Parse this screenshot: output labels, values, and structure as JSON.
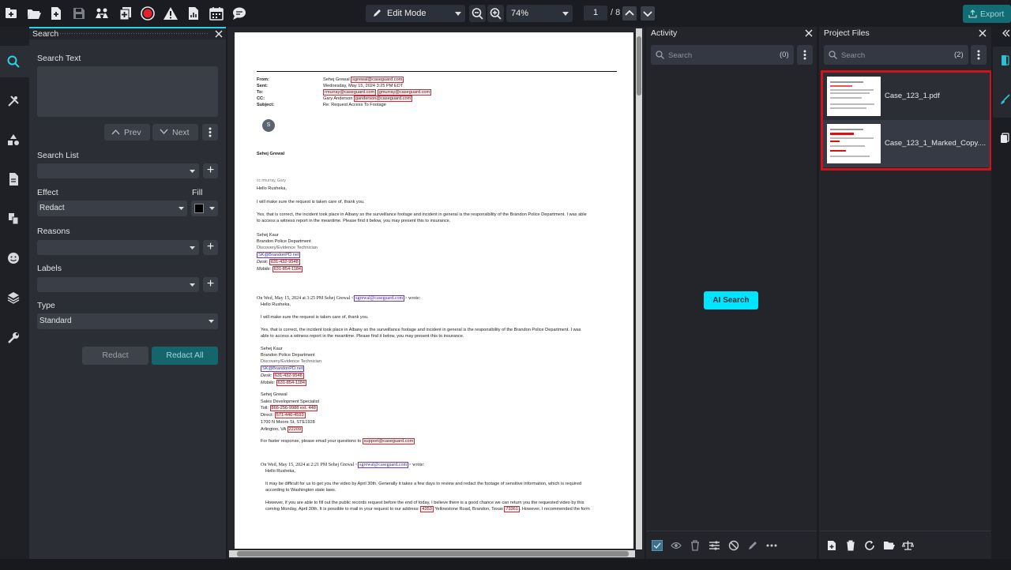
{
  "toolbar": {
    "icons": [
      "add-file-icon",
      "open-folder-icon",
      "new-document-icon",
      "save-icon",
      "users-icon",
      "insert-page-icon",
      "record-icon",
      "warning-icon",
      "report-icon",
      "calendar-icon",
      "chat-icon"
    ],
    "mode": "Edit Mode",
    "zoom": "74%",
    "page_current": "1",
    "page_total": "/ 8",
    "export_label": "Export"
  },
  "search_panel": {
    "title": "Search",
    "search_text_label": "Search Text",
    "prev_label": "Prev",
    "next_label": "Next",
    "search_list_label": "Search List",
    "effect_label": "Effect",
    "fill_label": "Fill",
    "effect_value": "Redact",
    "reasons_label": "Reasons",
    "labels_label": "Labels",
    "type_label": "Type",
    "type_value": "Standard",
    "redact_label": "Redact",
    "redact_all_label": "Redact All"
  },
  "activity": {
    "title": "Activity",
    "search_placeholder": "Search",
    "count": "(0)",
    "ai_search_label": "AI Search"
  },
  "project_files": {
    "title": "Project Files",
    "search_placeholder": "Search",
    "count": "(2)",
    "files": [
      {
        "name": "Case_123_1.pdf"
      },
      {
        "name": "Case_123_1_Marked_Copy...."
      }
    ]
  },
  "document": {
    "header": {
      "from_label": "From:",
      "sent_label": "Sent:",
      "to_label": "To:",
      "cc_label": "CC:",
      "subject_label": "Subject:",
      "from_name": "Sehej Grewal",
      "from_email": "sgrewal@caseguard.com",
      "sent": "Wednesday, May 15, 2024 3:25 PM EDT",
      "to_email1": "rmurray@caseguard.com",
      "to_email2": "gmurray@caseguard.com",
      "cc_name": "Gary Anderson",
      "cc_email": "ganderson@caseguard.com",
      "subject": "Re: Request Access To Footage"
    },
    "avatar_letter": "S",
    "sender": "Sehej Grewal",
    "cc_line": "cc rmurray, Gary",
    "greeting": "Hello Rusheka,",
    "p1": "I will make sure the request is taken care of, thank you.",
    "p2a": "Yes, that is correct, the incident took place in Albany so the surveillance footage and incident in general is the responsibility of the Brandon Police Department. I was able",
    "p2b": "to access a witness report in the meantime. Please find it below, you may present this to insurance.",
    "sig1": {
      "name": "Sehej Kaur",
      "dept": "Brandon Police Department",
      "role": "Discovery/Evidence Technician",
      "email": "SK@BrandonPD.net",
      "desk_label": "Desk:",
      "desk": "631-432-9548",
      "mobile_label": "Mobile:",
      "mobile": "631-854-1184"
    },
    "quote1_header_pre": "On Wed, May 15, 2024 at 3:25 PM Sehej Grewal <",
    "quote1_email": "sgrewal@caseguard.com",
    "quote1_header_post": "> wrote:",
    "q_greeting": "Hello Rusheka,",
    "q_p1": "I will make sure the request is taken care of, thank you.",
    "q_p2a": "Yes, that is correct, the incident took place in Albany so the surveillance footage and incident in general is the responsibility of the Brandon Police Department. I was",
    "q_p2b": "able to access a witness report in the meantime. Please find it below, you may present this to insurance.",
    "sig2": {
      "name": "Sehej Kaur",
      "dept": "Brandon Police Department",
      "role": "Discovery/Evidence Technician",
      "email": "SK@BrandonPD.net",
      "desk_label": "Desk:",
      "desk": "631-432-9548",
      "mobile_label": "Mobile:",
      "mobile": "631-854-1184"
    },
    "sig3": {
      "name": "Sehej Grewal",
      "title": "Sales Development Specialist",
      "toll_label": "Toll:",
      "toll": "866-256-9988 ext. 448",
      "direct_label": "Direct:",
      "direct": "571-446-4593",
      "addr": "1700 N Moore St, STE1928",
      "city": "Arlington, VA",
      "zip": "22209"
    },
    "faster_pre": "For faster response, please email your questions to",
    "faster_email": "support@caseguard.com",
    "quote2_header_pre": "On Wed, May 15, 2024 at 2:21 PM Sehej Grewal <",
    "quote2_email": "sgrewal@caseguard.com",
    "quote2_header_post": "> wrote:",
    "q2_greeting": "Hello Rusheka,",
    "q2_p1a": "It may be difficult for us to get you the video by April 30th. Generally it takes a few days to review and redact the footage of sensitive information, which is required",
    "q2_p1b": "according to Washington state laws.",
    "q2_p2a": "However, if you are able to fill out the public records request before the end of today, I believe there is a good chance we can return you the requested video by this",
    "q2_p2b_pre": "coming Monday, April 30th. It is possible to mail in your request to our address:",
    "q2_num": "4353",
    "q2_road": "Yellowstone Road, Brandon, Texas",
    "q2_zip": "73361",
    "q2_p2b_post": ". However, I recommended the form"
  },
  "colors": {
    "accent": "#00e5ff",
    "redact": "#c0303a",
    "highlight_box": "#d0121b",
    "export": "#126c73"
  }
}
